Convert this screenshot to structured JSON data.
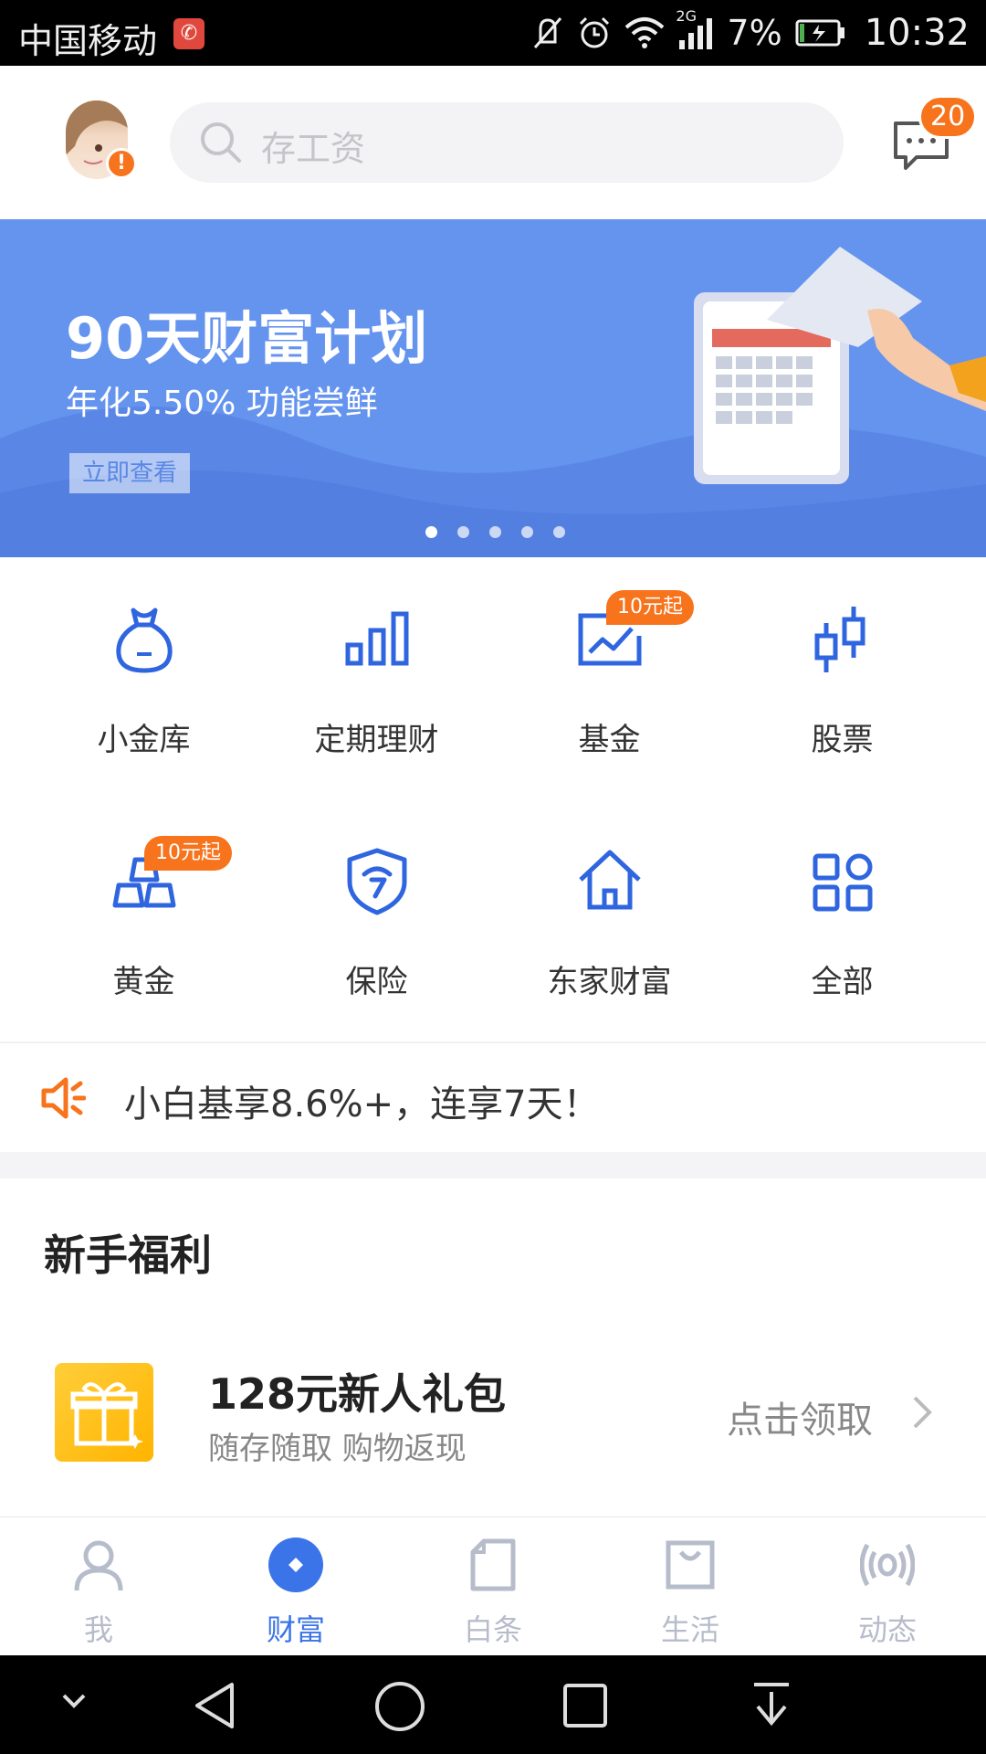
{
  "status_bar": {
    "carrier": "中国移动",
    "network": "2G",
    "battery_percent": "7%",
    "time": "10:32"
  },
  "header": {
    "search_placeholder": "存工资",
    "message_count": "20",
    "avatar_alert": "!"
  },
  "banner": {
    "title": "90天财富计划",
    "subtitle": "年化5.50%   功能尝鲜",
    "cta": "立即查看",
    "page_count": 5,
    "active_index": 0
  },
  "grid": {
    "items": [
      {
        "label": "小金库",
        "icon": "money-bag-icon"
      },
      {
        "label": "定期理财",
        "icon": "bar-chart-icon"
      },
      {
        "label": "基金",
        "icon": "trend-chart-icon",
        "tag": "10元起"
      },
      {
        "label": "股票",
        "icon": "candlestick-icon"
      },
      {
        "label": "黄金",
        "icon": "gold-bars-icon",
        "tag": "10元起"
      },
      {
        "label": "保险",
        "icon": "shield-icon"
      },
      {
        "label": "东家财富",
        "icon": "house-icon"
      },
      {
        "label": "全部",
        "icon": "grid-apps-icon"
      }
    ]
  },
  "notice": {
    "text": "小白基享8.6%+，连享7天！"
  },
  "welfare": {
    "section_title": "新手福利",
    "gift_title": "128元新人礼包",
    "gift_subtitle": "随存随取 购物返现",
    "action": "点击领取"
  },
  "tabbar": {
    "tabs": [
      {
        "label": "我"
      },
      {
        "label": "财富"
      },
      {
        "label": "白条"
      },
      {
        "label": "生活"
      },
      {
        "label": "动态"
      }
    ],
    "active": "财富"
  },
  "colors": {
    "accent": "#3a74e8",
    "icon_blue": "#2f66e0",
    "orange": "#f7731c",
    "banner_bg": "#6594ef"
  }
}
